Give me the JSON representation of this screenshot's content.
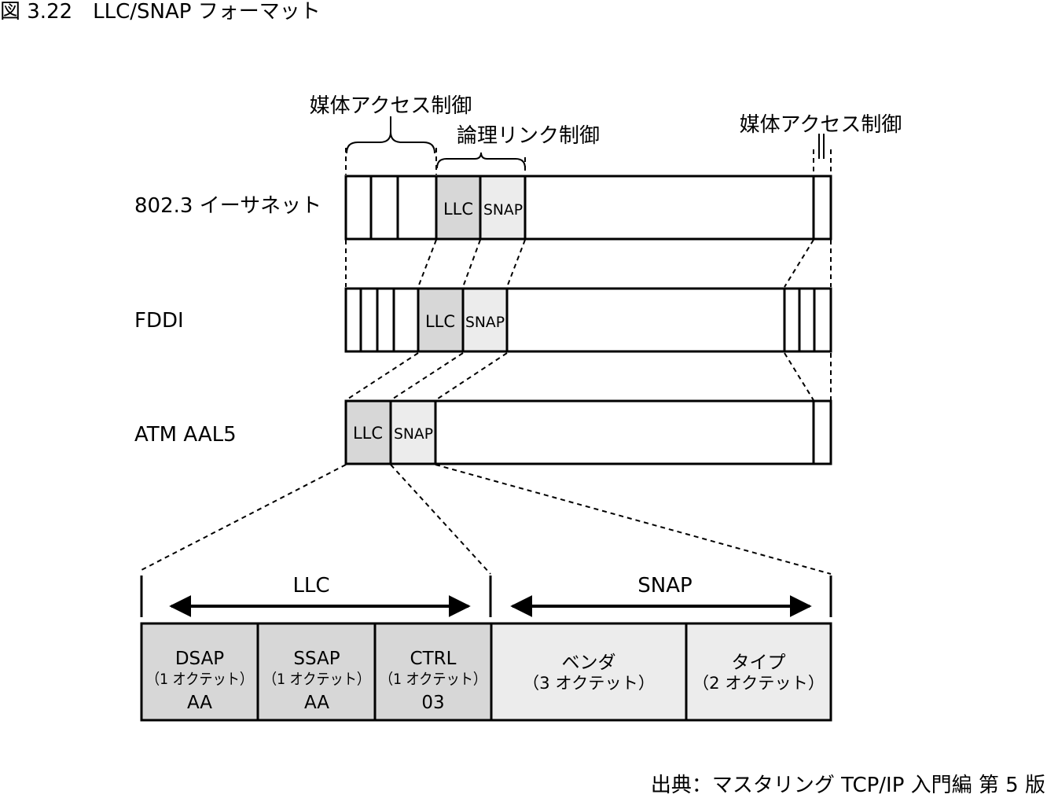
{
  "figure_title": "図 3.22　LLC/SNAP フォーマット",
  "source": "出典：マスタリング TCP/IP 入門編 第 5 版",
  "annotations": {
    "mac_left": "媒体アクセス制御",
    "llc_label": "論理リンク制御",
    "mac_right": "媒体アクセス制御"
  },
  "rows": [
    {
      "label": "802.3 イーサネット",
      "llc": "LLC",
      "snap": "SNAP"
    },
    {
      "label": "FDDI",
      "llc": "LLC",
      "snap": "SNAP"
    },
    {
      "label": "ATM AAL5",
      "llc": "LLC",
      "snap": "SNAP"
    }
  ],
  "detail": {
    "llc_span_label": "LLC",
    "snap_span_label": "SNAP",
    "fields": [
      {
        "name": "DSAP",
        "size": "（1 オクテット）",
        "value": "AA",
        "group": "llc"
      },
      {
        "name": "SSAP",
        "size": "（1 オクテット）",
        "value": "AA",
        "group": "llc"
      },
      {
        "name": "CTRL",
        "size": "（1 オクテット）",
        "value": "03",
        "group": "llc"
      },
      {
        "name": "ベンダ",
        "size": "（3 オクテット）",
        "value": "",
        "group": "snap"
      },
      {
        "name": "タイプ",
        "size": "（2 オクテット）",
        "value": "",
        "group": "snap"
      }
    ]
  },
  "colors": {
    "llc_fill": "#d7d7d7",
    "snap_fill": "#ececec",
    "stroke": "#000000"
  }
}
